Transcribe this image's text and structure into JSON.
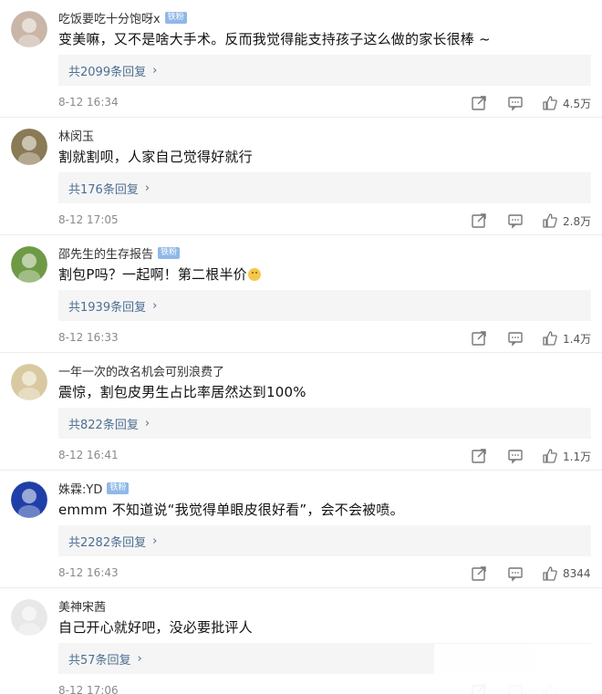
{
  "comments": [
    {
      "name": "吃饭要吃十分饱呀x",
      "badge": "铁粉",
      "text": "变美嘛，又不是啥大手术。反而我觉得能支持孩子这么做的家长很棒 ~",
      "replies": "共2099条回复",
      "time": "8-12 16:34",
      "likes": "4.5万",
      "avatar_color": "#c9b6a8"
    },
    {
      "name": "林闵玉",
      "badge": "",
      "text": "割就割呗，人家自己觉得好就行",
      "replies": "共176条回复",
      "time": "8-12 17:05",
      "likes": "2.8万",
      "avatar_color": "#8a7a55"
    },
    {
      "name": "邵先生的生存报告",
      "badge": "铁粉",
      "text": "割包P吗？一起啊！第二根半价",
      "replies": "共1939条回复",
      "time": "8-12 16:33",
      "likes": "1.4万",
      "avatar_color": "#6f9a45"
    },
    {
      "name": "一年一次的改名机会可别浪费了",
      "badge": "",
      "text": "震惊，割包皮男生占比率居然达到100%",
      "replies": "共822条回复",
      "time": "8-12 16:41",
      "likes": "1.1万",
      "avatar_color": "#d9c9a0"
    },
    {
      "name": "姝霖:YD",
      "badge": "铁粉",
      "text": "emmm  不知道说“我觉得单眼皮很好看”，会不会被喷。",
      "replies": "共2282条回复",
      "time": "8-12 16:43",
      "likes": "8344",
      "avatar_color": "#1f3fa8"
    },
    {
      "name": "美神宋茜",
      "badge": "",
      "text": "自己开心就好吧，没必要批评人",
      "replies": "共57条回复",
      "time": "8-12 17:06",
      "likes": "",
      "avatar_color": "#e8e8e8"
    }
  ],
  "icons": {
    "share": "share-icon",
    "comment": "comment-icon",
    "like": "thumbs-up-icon",
    "emoji": "smile-emoji-icon",
    "chevron": "chevron-right-icon"
  },
  "colors": {
    "reply_link": "#4d6f92",
    "badge": "#8fb8e8",
    "meta": "#8a8a8a"
  }
}
